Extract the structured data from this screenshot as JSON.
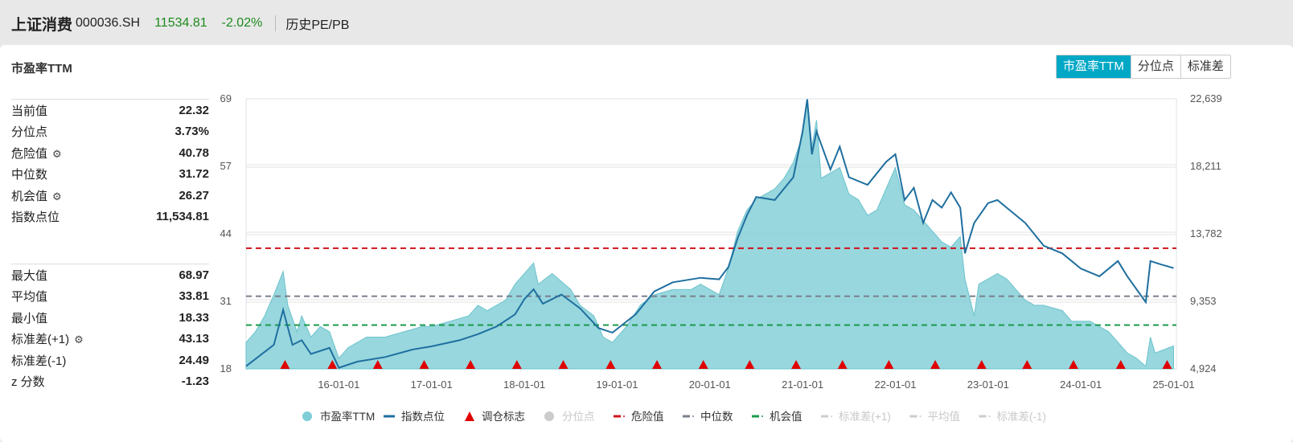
{
  "header": {
    "name": "上证消费",
    "code": "000036.SH",
    "price": "11534.81",
    "change": "-2.02%",
    "link": "历史PE/PB"
  },
  "card": {
    "title": "市盈率TTM",
    "tabs": [
      "市盈率TTM",
      "分位点",
      "标准差"
    ]
  },
  "stats_top": [
    {
      "label": "当前值",
      "value": "22.32"
    },
    {
      "label": "分位点",
      "value": "3.73%"
    },
    {
      "label": "危险值",
      "value": "40.78",
      "gear": true
    },
    {
      "label": "中位数",
      "value": "31.72"
    },
    {
      "label": "机会值",
      "value": "26.27",
      "gear": true
    },
    {
      "label": "指数点位",
      "value": "11,534.81"
    }
  ],
  "stats_bottom": [
    {
      "label": "最大值",
      "value": "68.97"
    },
    {
      "label": "平均值",
      "value": "33.81"
    },
    {
      "label": "最小值",
      "value": "18.33"
    },
    {
      "label": "标准差(+1)",
      "value": "43.13",
      "gear": true
    },
    {
      "label": "标准差(-1)",
      "value": "24.49"
    },
    {
      "label": "z 分数",
      "value": "-1.23"
    }
  ],
  "chart_data": {
    "type": "area",
    "x_ticks": [
      "16-01-01",
      "17-01-01",
      "18-01-01",
      "19-01-01",
      "20-01-01",
      "21-01-01",
      "22-01-01",
      "23-01-01",
      "24-01-01",
      "25-01-01"
    ],
    "xlim": [
      2015.0,
      2025.03
    ],
    "y_left": {
      "ticks": [
        "69",
        "57",
        "44",
        "31",
        "18"
      ],
      "range": [
        18,
        69
      ]
    },
    "y_right": {
      "ticks": [
        "22,639",
        "18,211",
        "13,782",
        "9,353",
        "4,924"
      ],
      "range": [
        4924,
        22639
      ]
    },
    "colors": {
      "pe": "#7ecdd6",
      "index": "#1f6f9f",
      "danger": "#d0121b",
      "median": "#7a7f8c",
      "chance": "#1a9a4a",
      "rebalance": "#e00000"
    },
    "danger": 40.78,
    "median": 31.72,
    "chance": 26.27,
    "pe": [
      [
        2015.0,
        23
      ],
      [
        2015.1,
        25
      ],
      [
        2015.2,
        28
      ],
      [
        2015.3,
        32
      ],
      [
        2015.4,
        36.4
      ],
      [
        2015.45,
        30
      ],
      [
        2015.55,
        25
      ],
      [
        2015.6,
        28
      ],
      [
        2015.7,
        24
      ],
      [
        2015.8,
        26
      ],
      [
        2015.9,
        25
      ],
      [
        2016.0,
        20
      ],
      [
        2016.1,
        22
      ],
      [
        2016.2,
        23
      ],
      [
        2016.3,
        24
      ],
      [
        2016.5,
        24
      ],
      [
        2016.7,
        25
      ],
      [
        2016.9,
        26
      ],
      [
        2017.0,
        26
      ],
      [
        2017.2,
        27
      ],
      [
        2017.4,
        28
      ],
      [
        2017.5,
        30
      ],
      [
        2017.6,
        29
      ],
      [
        2017.8,
        31
      ],
      [
        2017.9,
        34
      ],
      [
        2018.0,
        36
      ],
      [
        2018.1,
        38
      ],
      [
        2018.15,
        34
      ],
      [
        2018.3,
        36
      ],
      [
        2018.5,
        33
      ],
      [
        2018.6,
        30
      ],
      [
        2018.75,
        28
      ],
      [
        2018.85,
        24
      ],
      [
        2018.95,
        23
      ],
      [
        2019.1,
        26
      ],
      [
        2019.25,
        30
      ],
      [
        2019.4,
        32
      ],
      [
        2019.6,
        33
      ],
      [
        2019.8,
        33
      ],
      [
        2019.9,
        34
      ],
      [
        2020.0,
        33
      ],
      [
        2020.1,
        32
      ],
      [
        2020.2,
        37
      ],
      [
        2020.3,
        44
      ],
      [
        2020.4,
        48
      ],
      [
        2020.5,
        50
      ],
      [
        2020.6,
        51
      ],
      [
        2020.7,
        52
      ],
      [
        2020.8,
        54
      ],
      [
        2020.9,
        57
      ],
      [
        2021.0,
        62
      ],
      [
        2021.05,
        68.97
      ],
      [
        2021.1,
        60
      ],
      [
        2021.15,
        65
      ],
      [
        2021.2,
        54
      ],
      [
        2021.3,
        55
      ],
      [
        2021.4,
        56
      ],
      [
        2021.5,
        51
      ],
      [
        2021.6,
        50
      ],
      [
        2021.7,
        47
      ],
      [
        2021.8,
        48
      ],
      [
        2021.9,
        52
      ],
      [
        2022.0,
        56
      ],
      [
        2022.1,
        49
      ],
      [
        2022.2,
        48
      ],
      [
        2022.3,
        46
      ],
      [
        2022.4,
        44
      ],
      [
        2022.5,
        42
      ],
      [
        2022.6,
        41
      ],
      [
        2022.7,
        43
      ],
      [
        2022.75,
        35
      ],
      [
        2022.85,
        28
      ],
      [
        2022.9,
        34
      ],
      [
        2023.0,
        35
      ],
      [
        2023.1,
        36
      ],
      [
        2023.2,
        35
      ],
      [
        2023.3,
        33
      ],
      [
        2023.4,
        31
      ],
      [
        2023.5,
        30
      ],
      [
        2023.6,
        30
      ],
      [
        2023.8,
        29
      ],
      [
        2023.9,
        27
      ],
      [
        2024.1,
        27
      ],
      [
        2024.3,
        25
      ],
      [
        2024.5,
        21
      ],
      [
        2024.6,
        20
      ],
      [
        2024.7,
        18.5
      ],
      [
        2024.75,
        24
      ],
      [
        2024.8,
        21
      ],
      [
        2025.0,
        22.32
      ]
    ],
    "index": [
      [
        2015.0,
        5100
      ],
      [
        2015.3,
        6500
      ],
      [
        2015.4,
        8800
      ],
      [
        2015.5,
        6500
      ],
      [
        2015.6,
        6800
      ],
      [
        2015.7,
        5900
      ],
      [
        2015.9,
        6300
      ],
      [
        2016.0,
        5000
      ],
      [
        2016.2,
        5400
      ],
      [
        2016.5,
        5700
      ],
      [
        2016.8,
        6200
      ],
      [
        2017.0,
        6400
      ],
      [
        2017.3,
        6800
      ],
      [
        2017.5,
        7200
      ],
      [
        2017.7,
        7700
      ],
      [
        2017.9,
        8500
      ],
      [
        2018.0,
        9500
      ],
      [
        2018.1,
        10144
      ],
      [
        2018.2,
        9200
      ],
      [
        2018.4,
        9800
      ],
      [
        2018.6,
        8900
      ],
      [
        2018.8,
        7600
      ],
      [
        2018.95,
        7300
      ],
      [
        2019.2,
        8500
      ],
      [
        2019.4,
        10000
      ],
      [
        2019.6,
        10600
      ],
      [
        2019.9,
        10900
      ],
      [
        2020.1,
        10800
      ],
      [
        2020.2,
        11600
      ],
      [
        2020.3,
        13500
      ],
      [
        2020.4,
        15000
      ],
      [
        2020.5,
        16200
      ],
      [
        2020.7,
        16000
      ],
      [
        2020.9,
        17500
      ],
      [
        2021.0,
        20500
      ],
      [
        2021.05,
        22600
      ],
      [
        2021.1,
        19000
      ],
      [
        2021.15,
        20500
      ],
      [
        2021.3,
        18000
      ],
      [
        2021.4,
        19500
      ],
      [
        2021.5,
        17500
      ],
      [
        2021.7,
        17000
      ],
      [
        2021.9,
        18500
      ],
      [
        2022.0,
        19000
      ],
      [
        2022.1,
        16000
      ],
      [
        2022.2,
        16800
      ],
      [
        2022.3,
        14500
      ],
      [
        2022.4,
        16000
      ],
      [
        2022.5,
        15500
      ],
      [
        2022.6,
        16500
      ],
      [
        2022.7,
        15500
      ],
      [
        2022.75,
        12500
      ],
      [
        2022.85,
        14500
      ],
      [
        2023.0,
        15800
      ],
      [
        2023.1,
        16000
      ],
      [
        2023.2,
        15500
      ],
      [
        2023.4,
        14500
      ],
      [
        2023.6,
        13000
      ],
      [
        2023.8,
        12500
      ],
      [
        2024.0,
        11500
      ],
      [
        2024.2,
        11000
      ],
      [
        2024.4,
        12000
      ],
      [
        2024.5,
        11000
      ],
      [
        2024.7,
        9300
      ],
      [
        2024.75,
        12000
      ],
      [
        2024.85,
        11800
      ],
      [
        2025.0,
        11535
      ]
    ],
    "rebalance": [
      2015.42,
      2015.93,
      2016.42,
      2016.92,
      2017.42,
      2017.92,
      2018.42,
      2018.93,
      2019.43,
      2019.93,
      2020.43,
      2020.93,
      2021.43,
      2021.93,
      2022.43,
      2022.93,
      2023.42,
      2023.92,
      2024.43,
      2024.93
    ],
    "legend": [
      {
        "label": "市盈率TTM",
        "kind": "dot",
        "color": "#7ecdd6"
      },
      {
        "label": "指数点位",
        "kind": "line",
        "color": "#1f6f9f"
      },
      {
        "label": "调仓标志",
        "kind": "tri",
        "color": "#e00000"
      },
      {
        "label": "分位点",
        "kind": "dot",
        "color": "#cccccc",
        "off": true
      },
      {
        "label": "危险值",
        "kind": "dash",
        "color": "#d0121b"
      },
      {
        "label": "中位数",
        "kind": "dash",
        "color": "#7a7f8c"
      },
      {
        "label": "机会值",
        "kind": "dash",
        "color": "#1a9a4a"
      },
      {
        "label": "标准差(+1)",
        "kind": "dash",
        "color": "#cccccc",
        "off": true
      },
      {
        "label": "平均值",
        "kind": "dash",
        "color": "#cccccc",
        "off": true
      },
      {
        "label": "标准差(-1)",
        "kind": "dash",
        "color": "#cccccc",
        "off": true
      }
    ]
  }
}
